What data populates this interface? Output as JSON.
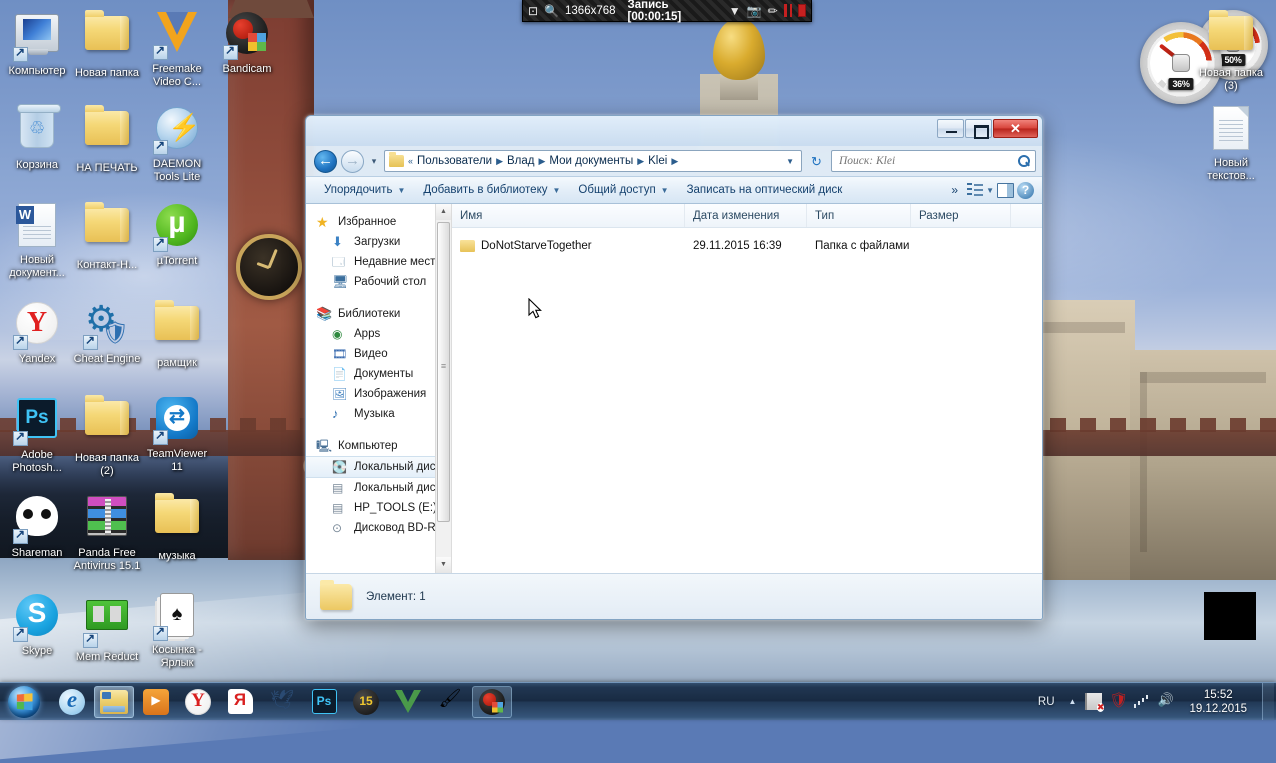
{
  "recording_bar": {
    "target_icon": "target-window-icon",
    "zoom_icon": "magnifier-icon",
    "resolution": "1366x768",
    "status": "Запись [00:00:15]",
    "dropdown_icon": "chevron-down-icon",
    "camera_icon": "camera-icon",
    "pencil_icon": "pencil-icon",
    "pause_icon": "pause-icon",
    "stop_icon": "stop-icon"
  },
  "desktop": {
    "icons_left": [
      {
        "label": "Компьютер",
        "icon": "computer-icon",
        "shortcut": true
      },
      {
        "label": "Новая папка",
        "icon": "folder-icon",
        "shortcut": false
      },
      {
        "label": "Freemake Video C...",
        "icon": "freemake-video-converter-icon",
        "shortcut": true
      },
      {
        "label": "Bandicam",
        "icon": "bandicam-icon",
        "shortcut": true
      },
      {
        "label": "Корзина",
        "icon": "recycle-bin-icon",
        "shortcut": false
      },
      {
        "label": "НА ПЕЧАТЬ",
        "icon": "folder-icon",
        "shortcut": false
      },
      {
        "label": "DAEMON Tools Lite",
        "icon": "daemon-tools-icon",
        "shortcut": true
      },
      {
        "label": "Новый документ...",
        "icon": "word-document-icon",
        "shortcut": false
      },
      {
        "label": "Контакт-Н...",
        "icon": "folder-icon",
        "shortcut": false
      },
      {
        "label": "µTorrent",
        "icon": "utorrent-icon",
        "shortcut": true
      },
      {
        "label": "Yandex",
        "icon": "yandex-browser-icon",
        "shortcut": true
      },
      {
        "label": "Cheat Engine",
        "icon": "cheat-engine-icon",
        "shortcut": true
      },
      {
        "label": "рамщик",
        "icon": "folder-icon",
        "shortcut": false
      },
      {
        "label": "Adobe Photosh...",
        "icon": "adobe-photoshop-icon",
        "shortcut": true
      },
      {
        "label": "Новая папка (2)",
        "icon": "folder-icon",
        "shortcut": false
      },
      {
        "label": "TeamViewer 11",
        "icon": "teamviewer-icon",
        "shortcut": true
      },
      {
        "label": "Shareman",
        "icon": "shareman-icon",
        "shortcut": true
      },
      {
        "label": "Panda Free Antivirus 15.1",
        "icon": "winrar-archive-icon",
        "shortcut": false
      },
      {
        "label": "музыка",
        "icon": "folder-icon",
        "shortcut": false
      },
      {
        "label": "Skype",
        "icon": "skype-icon",
        "shortcut": true
      },
      {
        "label": "Mem Reduct",
        "icon": "mem-reduct-icon",
        "shortcut": true
      },
      {
        "label": "Косынка - Ярлык",
        "icon": "solitaire-icon",
        "shortcut": true
      }
    ],
    "icons_right": [
      {
        "label": "Новая папка (3)",
        "icon": "folder-icon",
        "shortcut": false
      },
      {
        "label": "Новый текстов...",
        "icon": "text-document-icon",
        "shortcut": false
      }
    ],
    "gadgets": {
      "cpu_meter": {
        "name": "cpu-meter-gadget",
        "value": "36%"
      },
      "memory_meter": {
        "name": "memory-meter-gadget",
        "value": "50%"
      }
    }
  },
  "explorer": {
    "title_bar": {
      "minimize": "minimize-button",
      "maximize": "maximize-button",
      "close": "close-button"
    },
    "address": {
      "back_icon": "back-arrow-icon",
      "forward_icon": "forward-arrow-icon",
      "history_icon": "chevron-down-icon",
      "folder_icon": "folder-icon",
      "overflow": "«",
      "crumbs": [
        "Пользователи",
        "Влад",
        "Мои документы",
        "Klei"
      ],
      "separator": "▶",
      "dropdown_icon": "chevron-down-icon",
      "refresh_icon": "refresh-icon"
    },
    "search": {
      "placeholder": "Поиск: Klei",
      "value": "",
      "icon": "search-icon"
    },
    "toolbar": {
      "organize": "Упорядочить",
      "add_to_library": "Добавить в библиотеку",
      "share": "Общий доступ",
      "burn": "Записать на оптический диск",
      "overflow": "»",
      "view_icon": "list-view-icon",
      "view_caret": "chevron-down-icon",
      "preview_pane_icon": "preview-pane-icon",
      "help_icon": "help-icon"
    },
    "navpane": {
      "groups": [
        {
          "head": {
            "label": "Избранное",
            "icon": "favorites-star-icon"
          },
          "children": [
            {
              "label": "Загрузки",
              "icon": "downloads-icon"
            },
            {
              "label": "Недавние места",
              "icon": "recent-places-icon"
            },
            {
              "label": "Рабочий стол",
              "icon": "desktop-icon"
            }
          ]
        },
        {
          "head": {
            "label": "Библиотеки",
            "icon": "libraries-icon"
          },
          "children": [
            {
              "label": "Apps",
              "icon": "apps-library-icon"
            },
            {
              "label": "Видео",
              "icon": "video-library-icon"
            },
            {
              "label": "Документы",
              "icon": "documents-library-icon"
            },
            {
              "label": "Изображения",
              "icon": "pictures-library-icon"
            },
            {
              "label": "Музыка",
              "icon": "music-library-icon"
            }
          ]
        },
        {
          "head": {
            "label": "Компьютер",
            "icon": "computer-icon"
          },
          "children": [
            {
              "label": "Локальный диск",
              "icon": "system-drive-icon",
              "selected": true
            },
            {
              "label": "Локальный диск",
              "icon": "drive-icon"
            },
            {
              "label": "HP_TOOLS (E:)",
              "icon": "drive-icon"
            },
            {
              "label": "Дисковод BD-RO",
              "icon": "optical-drive-icon"
            }
          ]
        }
      ],
      "scrollbar": {
        "up_icon": "scroll-up-icon",
        "down_icon": "scroll-down-icon",
        "thumb": "scroll-thumb"
      }
    },
    "columns": [
      {
        "key": "name",
        "label": "Имя"
      },
      {
        "key": "date",
        "label": "Дата изменения"
      },
      {
        "key": "type",
        "label": "Тип"
      },
      {
        "key": "size",
        "label": "Размер"
      }
    ],
    "rows": [
      {
        "icon": "folder-icon",
        "name": "DoNotStarveTogether",
        "date": "29.11.2015 16:39",
        "type": "Папка с файлами",
        "size": ""
      }
    ],
    "status": {
      "icon": "folder-icon",
      "text": "Элемент: 1"
    }
  },
  "taskbar": {
    "start": {
      "name": "start-orb",
      "icon": "windows-logo-icon"
    },
    "apps": [
      {
        "name": "internet-explorer",
        "icon": "internet-explorer-icon",
        "state": "pinned"
      },
      {
        "name": "windows-explorer",
        "icon": "folder-icon",
        "state": "active"
      },
      {
        "name": "media-player",
        "icon": "media-player-icon",
        "state": "pinned"
      },
      {
        "name": "yandex-browser",
        "icon": "yandex-browser-icon",
        "state": "pinned"
      },
      {
        "name": "yandex-app",
        "icon": "yandex-icon",
        "state": "pinned"
      },
      {
        "name": "bird-app",
        "icon": "bird-icon",
        "state": "pinned"
      },
      {
        "name": "photoshop",
        "icon": "adobe-photoshop-icon",
        "state": "pinned"
      },
      {
        "name": "app-15",
        "icon": "game-15-icon",
        "state": "pinned"
      },
      {
        "name": "freemake",
        "icon": "freemake-video-converter-icon",
        "state": "pinned"
      },
      {
        "name": "paint",
        "icon": "paint-brush-icon",
        "state": "pinned"
      },
      {
        "name": "bandicam",
        "icon": "bandicam-icon",
        "state": "running"
      }
    ],
    "tray": {
      "language": "RU",
      "expand_icon": "show-hidden-icons-icon",
      "icons": [
        {
          "name": "action-center-icon"
        },
        {
          "name": "antivirus-shield-icon"
        },
        {
          "name": "network-icon"
        },
        {
          "name": "volume-icon"
        }
      ],
      "clock": {
        "time": "15:52",
        "date": "19.12.2015"
      },
      "show_desktop": "show-desktop-button"
    }
  }
}
